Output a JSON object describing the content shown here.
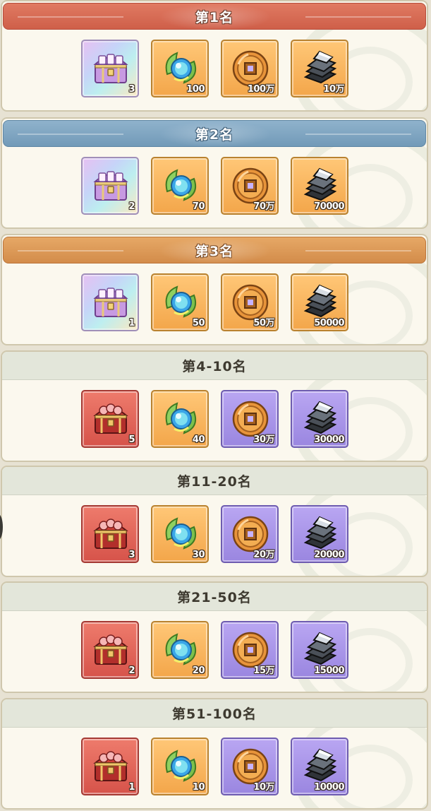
{
  "colors": {
    "banner_rank1": "#d5674f",
    "banner_rank2": "#7ea4c1",
    "banner_rank3": "#dc9955",
    "banner_plain": "#e3e6da",
    "card_bg": "#fbf8ee"
  },
  "tiers": [
    {
      "title": "第1名",
      "style": "rank1",
      "rewards": [
        {
          "icon": "rainbow-chest-icon",
          "quality": "rainbow",
          "qty": "3"
        },
        {
          "icon": "spirit-orb-leaf-icon",
          "quality": "orange",
          "qty": "100"
        },
        {
          "icon": "copper-coin-icon",
          "quality": "orange",
          "qty": "100万"
        },
        {
          "icon": "iron-ingot-icon",
          "quality": "orange",
          "qty": "10万"
        }
      ]
    },
    {
      "title": "第2名",
      "style": "rank2",
      "rewards": [
        {
          "icon": "rainbow-chest-icon",
          "quality": "rainbow",
          "qty": "2"
        },
        {
          "icon": "spirit-orb-leaf-icon",
          "quality": "orange",
          "qty": "70"
        },
        {
          "icon": "copper-coin-icon",
          "quality": "orange",
          "qty": "70万"
        },
        {
          "icon": "iron-ingot-icon",
          "quality": "orange",
          "qty": "70000"
        }
      ]
    },
    {
      "title": "第3名",
      "style": "rank3",
      "rewards": [
        {
          "icon": "rainbow-chest-icon",
          "quality": "rainbow",
          "qty": "1"
        },
        {
          "icon": "spirit-orb-leaf-icon",
          "quality": "orange",
          "qty": "50"
        },
        {
          "icon": "copper-coin-icon",
          "quality": "orange",
          "qty": "50万"
        },
        {
          "icon": "iron-ingot-icon",
          "quality": "orange",
          "qty": "50000"
        }
      ]
    },
    {
      "title": "第4-10名",
      "style": "plain",
      "rewards": [
        {
          "icon": "red-chest-icon",
          "quality": "red",
          "qty": "5"
        },
        {
          "icon": "spirit-orb-leaf-icon",
          "quality": "orange",
          "qty": "40"
        },
        {
          "icon": "copper-coin-icon",
          "quality": "purple",
          "qty": "30万"
        },
        {
          "icon": "iron-ingot-icon",
          "quality": "purple",
          "qty": "30000"
        }
      ]
    },
    {
      "title": "第11-20名",
      "style": "plain",
      "rewards": [
        {
          "icon": "red-chest-icon",
          "quality": "red",
          "qty": "3"
        },
        {
          "icon": "spirit-orb-leaf-icon",
          "quality": "orange",
          "qty": "30"
        },
        {
          "icon": "copper-coin-icon",
          "quality": "purple",
          "qty": "20万"
        },
        {
          "icon": "iron-ingot-icon",
          "quality": "purple",
          "qty": "20000"
        }
      ]
    },
    {
      "title": "第21-50名",
      "style": "plain",
      "rewards": [
        {
          "icon": "red-chest-icon",
          "quality": "red",
          "qty": "2"
        },
        {
          "icon": "spirit-orb-leaf-icon",
          "quality": "orange",
          "qty": "20"
        },
        {
          "icon": "copper-coin-icon",
          "quality": "purple",
          "qty": "15万"
        },
        {
          "icon": "iron-ingot-icon",
          "quality": "purple",
          "qty": "15000"
        }
      ]
    },
    {
      "title": "第51-100名",
      "style": "plain",
      "rewards": [
        {
          "icon": "red-chest-icon",
          "quality": "red",
          "qty": "1"
        },
        {
          "icon": "spirit-orb-leaf-icon",
          "quality": "orange",
          "qty": "10"
        },
        {
          "icon": "copper-coin-icon",
          "quality": "purple",
          "qty": "10万"
        },
        {
          "icon": "iron-ingot-icon",
          "quality": "purple",
          "qty": "10000"
        }
      ]
    }
  ]
}
